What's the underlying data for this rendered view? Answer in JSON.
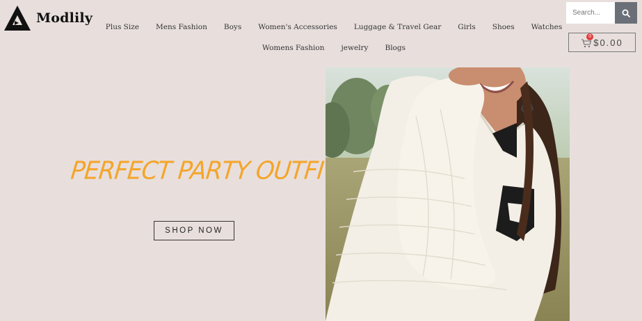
{
  "brand": {
    "name": "Modlily"
  },
  "nav": {
    "row1": [
      "Plus Size",
      "Mens Fashion",
      "Boys",
      "Women's Accessories",
      "Luggage & Travel Gear",
      "Girls",
      "Shoes",
      "Watches"
    ],
    "row2": [
      "Womens Fashion",
      "jewelry",
      "Blogs"
    ]
  },
  "search": {
    "placeholder": "Search...",
    "icon": "search-icon"
  },
  "cart": {
    "count": "0",
    "total": "$0.00",
    "icon": "cart-icon",
    "badge_color": "#e23b3b"
  },
  "hero": {
    "title": "PERFECT PARTY OUTFIT",
    "cta": "SHOP NOW",
    "title_color": "#f4a52a"
  },
  "colors": {
    "background": "#e8dfdd",
    "search_button": "#6b7078"
  }
}
